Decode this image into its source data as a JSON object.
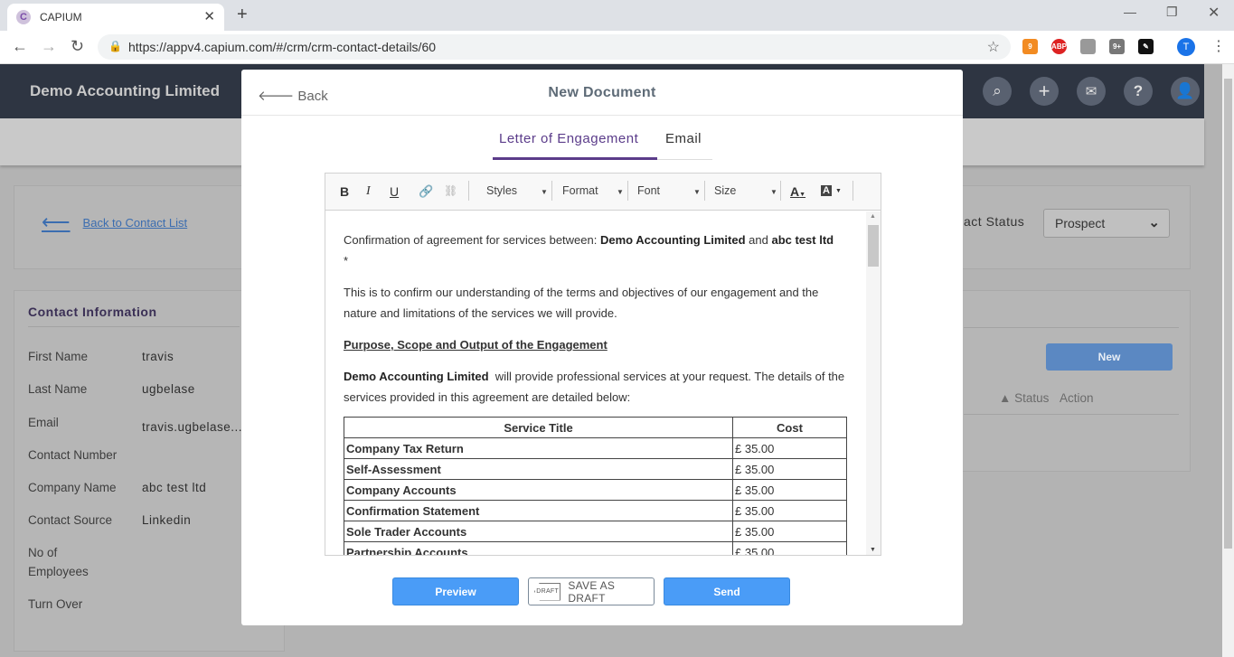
{
  "browser": {
    "tab_title": "CAPIUM",
    "tab_favicon": "C",
    "url": "https://appv4.capium.com/#/crm/crm-contact-details/60",
    "profile_initial": "T",
    "ext_badges": [
      "9",
      "ABP",
      "9+"
    ]
  },
  "app": {
    "brand": "Demo Accounting Limited",
    "back_to_list": "Back to Contact List",
    "contact_status_label": "act Status",
    "contact_status_value": "Prospect",
    "new_button": "New",
    "table_headers": [
      "▲ Status",
      "Action"
    ]
  },
  "contact_info": {
    "title": "Contact Information",
    "fields": [
      {
        "label": "First Name",
        "value": "travis"
      },
      {
        "label": "Last Name",
        "value": "ugbelase"
      },
      {
        "label": "Email",
        "value": "travis.ugbelase..."
      },
      {
        "label": "Contact Number",
        "value": ""
      },
      {
        "label": "Company Name",
        "value": "abc test ltd"
      },
      {
        "label": "Contact Source",
        "value": "Linkedin"
      },
      {
        "label": "No of",
        "value": ""
      },
      {
        "label": "Employees",
        "value": ""
      },
      {
        "label": "Turn Over",
        "value": ""
      }
    ]
  },
  "modal": {
    "back": "Back",
    "title": "New Document",
    "tabs": [
      "Letter of Engagement",
      "Email"
    ],
    "toolbar": {
      "styles": "Styles",
      "format": "Format",
      "font": "Font",
      "size": "Size"
    },
    "content": {
      "p1_pre": "Confirmation of agreement for services between: ",
      "p1_company": "Demo Accounting Limited",
      "p1_and": " and ",
      "p1_client": "abc test ltd",
      "p1_star": "*",
      "p2": "This is to confirm our understanding of the terms and objectives of our engagement and the nature and limitations of the services we will provide.",
      "heading": "Purpose, Scope and Output of the Engagement",
      "p3_company": "Demo Accounting Limited",
      "p3_rest": "  will provide professional services at your request. The details of the services provided in this agreement are detailed below:",
      "table_headers": [
        "Service Title",
        "Cost"
      ],
      "services": [
        {
          "title": "Company Tax Return",
          "cost": "£ 35.00"
        },
        {
          "title": "Self-Assessment",
          "cost": "£ 35.00"
        },
        {
          "title": "Company Accounts",
          "cost": "£ 35.00"
        },
        {
          "title": "Confirmation Statement",
          "cost": "£ 35.00"
        },
        {
          "title": "Sole Trader Accounts",
          "cost": "£ 35.00"
        },
        {
          "title": "Partnership Accounts",
          "cost": "£ 35.00"
        }
      ]
    },
    "buttons": {
      "preview": "Preview",
      "draft_tag": "DRAFT",
      "save_draft": "SAVE AS DRAFT",
      "send": "Send"
    }
  }
}
